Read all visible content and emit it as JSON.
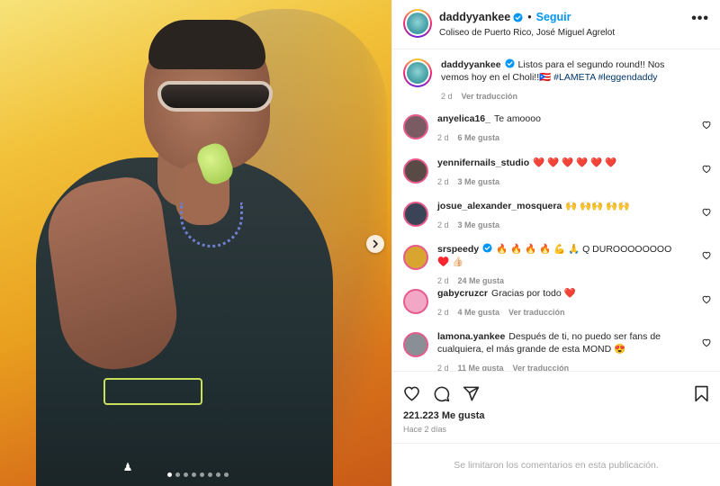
{
  "post": {
    "account": {
      "username": "daddyyankee",
      "verified": true,
      "follow_label": "Seguir",
      "separator": "•",
      "location": "Coliseo de Puerto Rico, José Miguel Agrelot"
    },
    "media": {
      "carousel_index": 1,
      "carousel_count": 8
    },
    "caption": {
      "username": "daddyyankee",
      "text": "Listos para el segundo round!! Nos vemos hoy en el Choli!!🇵🇷 ",
      "hashtags": "#LAMETA #leggendaddy",
      "age": "2 d",
      "translate_label": "Ver traducción"
    },
    "comments": [
      {
        "username": "anyelica16_",
        "text": "Te amoooo",
        "age": "2 d",
        "likes": "6 Me gusta",
        "translate": "",
        "avatar_color": "#7b5b63"
      },
      {
        "username": "yennifernails_studio",
        "text": "❤️ ❤️ ❤️ ❤️ ❤️ ❤️",
        "age": "2 d",
        "likes": "3 Me gusta",
        "translate": "",
        "avatar_color": "#5a4a46"
      },
      {
        "username": "josue_alexander_mosquera",
        "text": "🙌 🙌🙌 🙌🙌",
        "age": "2 d",
        "likes": "3 Me gusta",
        "translate": "",
        "avatar_color": "#3a4456"
      },
      {
        "username": "srspeedy",
        "verified": true,
        "text": "🔥 🔥 🔥 🔥 💪 🙏 Q DUROOOOOOOO ♥️ 👍🏻",
        "age": "2 d",
        "likes": "24 Me gusta",
        "translate": "",
        "avatar_color": "#d9a531"
      },
      {
        "username": "gabycruzcr",
        "text": "Gracias por todo ❤️",
        "age": "2 d",
        "likes": "4 Me gusta",
        "translate": "Ver traducción",
        "avatar_color": "#f2a7c6"
      },
      {
        "username": "lamona.yankee",
        "text": "Después de ti, no puedo ser fans de cualquiera, el más grande de esta MOND 😍",
        "age": "2 d",
        "likes": "11 Me gusta",
        "translate": "Ver traducción",
        "avatar_color": "#8a8f96"
      }
    ],
    "stats": {
      "likes": "221.223 Me gusta",
      "posted": "Hace 2 días"
    },
    "comments_limited": "Se limitaron los comentarios en esta publicación.",
    "icons": {
      "like": "heart-outline-icon",
      "comment": "comment-icon",
      "share": "send-icon",
      "save": "bookmark-icon",
      "more": "more-horizontal-icon",
      "next": "chevron-right-icon"
    },
    "colors": {
      "accent": "#0095f6",
      "verified": "#0095f6",
      "secondary_text": "#8e8e8e"
    }
  }
}
